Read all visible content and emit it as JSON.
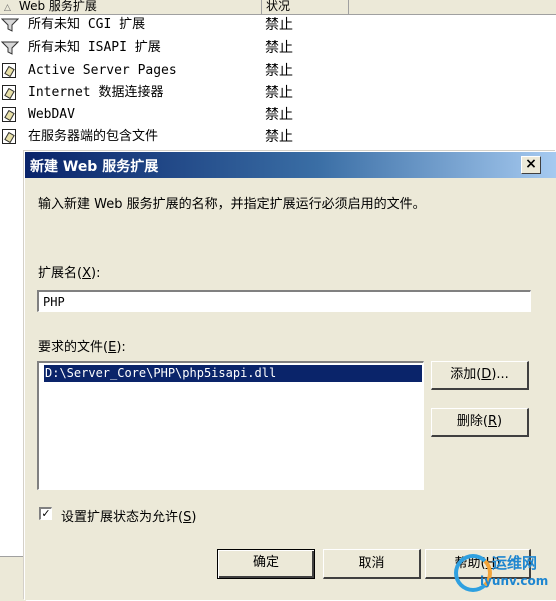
{
  "list": {
    "headers": {
      "name": "Web 服务扩展",
      "status": "状况"
    },
    "rows": [
      {
        "name": "所有未知 CGI 扩展",
        "status": "禁止",
        "icon": "filter-icon"
      },
      {
        "name": "所有未知 ISAPI 扩展",
        "status": "禁止",
        "icon": "filter-icon"
      },
      {
        "name": "Active Server Pages",
        "status": "禁止",
        "icon": "extension-icon"
      },
      {
        "name": "Internet 数据连接器",
        "status": "禁止",
        "icon": "extension-icon"
      },
      {
        "name": "WebDAV",
        "status": "禁止",
        "icon": "extension-icon"
      },
      {
        "name": "在服务器端的包含文件",
        "status": "禁止",
        "icon": "extension-icon"
      }
    ]
  },
  "dialog": {
    "title": "新建 Web 服务扩展",
    "close_label": "×",
    "instructions": "输入新建 Web 服务扩展的名称，并指定扩展运行必须启用的文件。",
    "ext_name_label": "扩展名",
    "ext_name_hotkey": "X",
    "ext_name_value": "PHP",
    "files_label": "要求的文件",
    "files_hotkey": "E",
    "files": [
      "D:\\Server_Core\\PHP\\php5isapi.dll"
    ],
    "add_label": "添加",
    "add_hotkey": "D",
    "remove_label": "删除",
    "remove_hotkey": "R",
    "checkbox_label": "设置扩展状态为允许",
    "checkbox_hotkey": "S",
    "checkbox_checked": true,
    "ok_label": "确定",
    "cancel_label": "取消",
    "help_label": "帮助",
    "help_hotkey": "H"
  },
  "watermark": {
    "line1": "运维网",
    "line2": "iyunv.com"
  },
  "colors": {
    "titlebar_start": "#0a246a",
    "titlebar_end": "#a6caf0",
    "dialog_bg": "#ece9d8",
    "selection": "#0a246a"
  }
}
